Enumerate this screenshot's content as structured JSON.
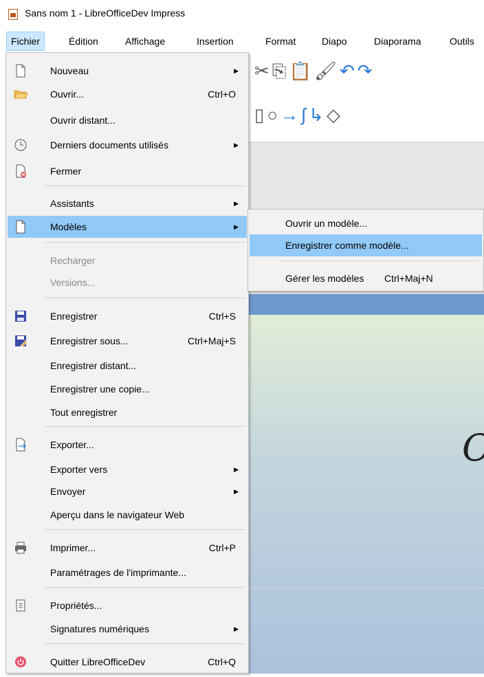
{
  "window": {
    "title": "Sans nom 1 - LibreOfficeDev Impress"
  },
  "menubar": {
    "items": [
      {
        "label": "Fichier"
      },
      {
        "label": "Édition"
      },
      {
        "label": "Affichage"
      },
      {
        "label": "Insertion"
      },
      {
        "label": "Format"
      },
      {
        "label": "Diapo"
      },
      {
        "label": "Diaporama"
      },
      {
        "label": "Outils"
      }
    ]
  },
  "file_menu": {
    "items": [
      {
        "label": "Nouveau",
        "icon": "new-document-icon",
        "submenu": true
      },
      {
        "label": "Ouvrir...",
        "shortcut": "Ctrl+O",
        "icon": "open-folder-icon"
      },
      {
        "label": "Ouvrir distant..."
      },
      {
        "label": "Derniers documents utilisés",
        "icon": "recent-clock-icon",
        "submenu": true
      },
      {
        "label": "Fermer",
        "icon": "close-document-icon"
      },
      {
        "label": "Assistants",
        "submenu": true
      },
      {
        "label": "Modèles",
        "icon": "templates-icon",
        "submenu": true,
        "state": "highlighted"
      },
      {
        "label": "Recharger",
        "state": "disabled"
      },
      {
        "label": "Versions...",
        "state": "disabled"
      },
      {
        "label": "Enregistrer",
        "shortcut": "Ctrl+S",
        "icon": "save-icon"
      },
      {
        "label": "Enregistrer sous...",
        "shortcut": "Ctrl+Maj+S",
        "icon": "save-as-icon"
      },
      {
        "label": "Enregistrer distant..."
      },
      {
        "label": "Enregistrer une copie..."
      },
      {
        "label": "Tout enregistrer"
      },
      {
        "label": "Exporter...",
        "icon": "export-icon"
      },
      {
        "label": "Exporter vers",
        "submenu": true
      },
      {
        "label": "Envoyer",
        "submenu": true
      },
      {
        "label": "Aperçu dans le navigateur Web"
      },
      {
        "label": "Imprimer...",
        "shortcut": "Ctrl+P",
        "icon": "printer-icon"
      },
      {
        "label": "Paramétrages de l'imprimante..."
      },
      {
        "label": "Propriétés...",
        "icon": "properties-icon"
      },
      {
        "label": "Signatures numériques",
        "submenu": true
      },
      {
        "label": "Quitter LibreOfficeDev",
        "shortcut": "Ctrl+Q",
        "icon": "power-icon"
      }
    ]
  },
  "templates_submenu": {
    "items": [
      {
        "label": "Ouvrir un modèle..."
      },
      {
        "label": "Enregistrer comme modèle...",
        "state": "highlighted"
      },
      {
        "label": "Gérer les modèles",
        "shortcut": "Ctrl+Maj+N"
      }
    ]
  },
  "colors": {
    "highlight": "#91c9f7",
    "menu_bg": "#f2f2f2",
    "menubar_active": "#cce8ff",
    "save_icon": "#3b4aa6",
    "slide_header": "#6d99cc"
  }
}
